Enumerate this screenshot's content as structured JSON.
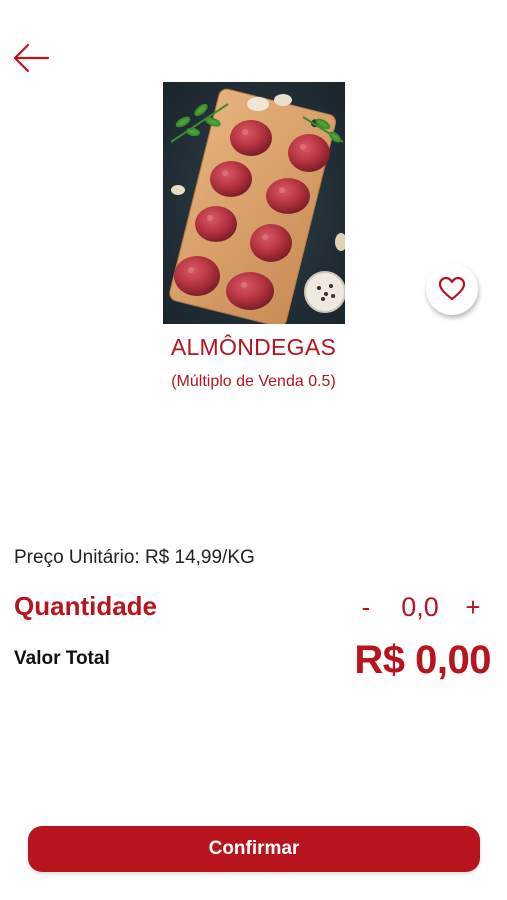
{
  "header": {
    "back_icon": "arrow-left-icon"
  },
  "product": {
    "image_alt": "meatballs-on-cutting-board",
    "name": "ALMÔNDEGAS",
    "sale_multiple": "(Múltiplo de Venda 0.5)",
    "favorite_icon": "heart-icon"
  },
  "pricing": {
    "unit_price": "Preço Unitário: R$ 14,99/KG",
    "quantity_label": "Quantidade",
    "decrement": "-",
    "quantity_value": "0,0",
    "increment": "+",
    "total_label": "Valor Total",
    "total_value": "R$ 0,00"
  },
  "footer": {
    "confirm_label": "Confirmar"
  },
  "colors": {
    "accent": "#b8141e",
    "text": "#222222",
    "background": "#ffffff"
  }
}
